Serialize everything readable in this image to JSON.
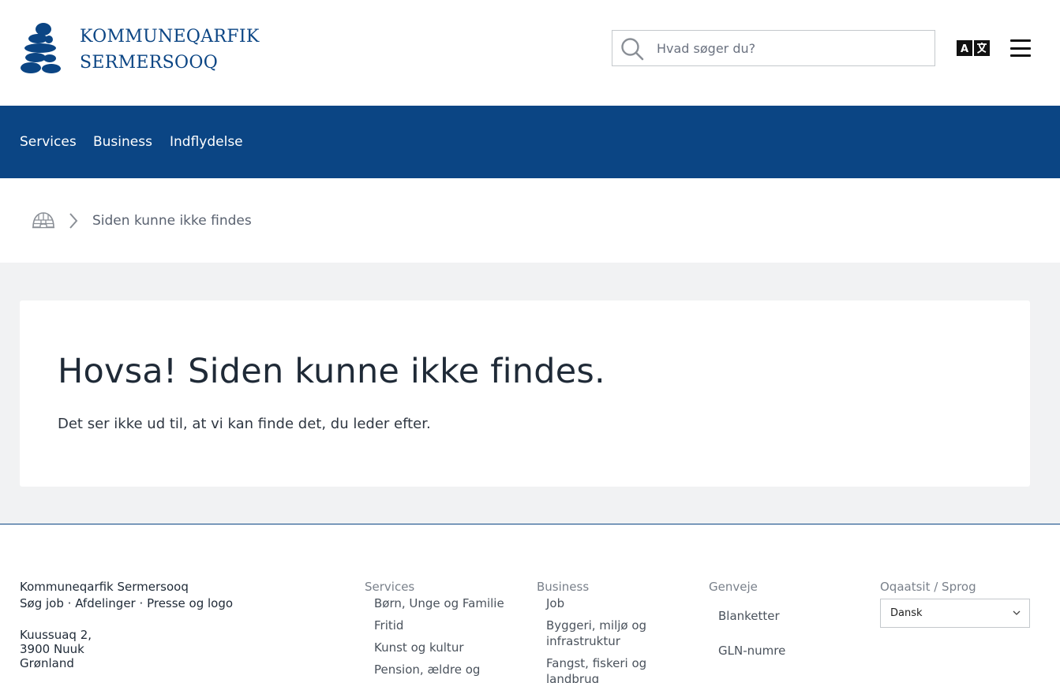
{
  "header": {
    "brand_line1": "KOMMUNEQARFIK",
    "brand_line2": "SERMERSOOQ",
    "logo_icon": "inuksuk-logo-icon",
    "search": {
      "placeholder": "Hvad søger du?",
      "value": ""
    },
    "translate_icon": "translate-icon",
    "menu_icon": "hamburger-menu-icon"
  },
  "nav": {
    "items": [
      {
        "label": "Services"
      },
      {
        "label": "Business"
      },
      {
        "label": "Indflydelse"
      }
    ]
  },
  "breadcrumb": {
    "home_icon": "igloo-home-icon",
    "separator_icon": "chevron-right-icon",
    "current": "Siden kunne ikke findes"
  },
  "main": {
    "title": "Hovsa! Siden kunne ikke findes.",
    "message": "Det ser ikke ud til, at vi kan finde det, du leder efter."
  },
  "footer": {
    "org": "Kommuneqarfik Sermersooq",
    "links": [
      "Søg job",
      "Afdelinger",
      "Presse og logo"
    ],
    "link_separator": "·",
    "address": [
      "Kuussuaq 2,",
      "3900 Nuuk",
      "Grønland"
    ],
    "columns": [
      {
        "heading": "Services",
        "items": [
          "Børn, Unge og Familie",
          "Fritid",
          "Kunst og kultur",
          "Pension, ældre og"
        ]
      },
      {
        "heading": "Business",
        "items": [
          "Job",
          "Byggeri, miljø og",
          "infrastruktur",
          "Fangst, fiskeri og",
          "landbrug"
        ]
      },
      {
        "heading": "Genveje",
        "items": [
          "Blanketter",
          "GLN-numre"
        ]
      }
    ],
    "language": {
      "heading": "Oqaatsit / Sprog",
      "selected": "Dansk"
    }
  },
  "colors": {
    "brand_blue": "#0b4584",
    "page_bg": "#f1f2f3",
    "text_dark": "#1f2a37",
    "muted": "#7a818b"
  }
}
